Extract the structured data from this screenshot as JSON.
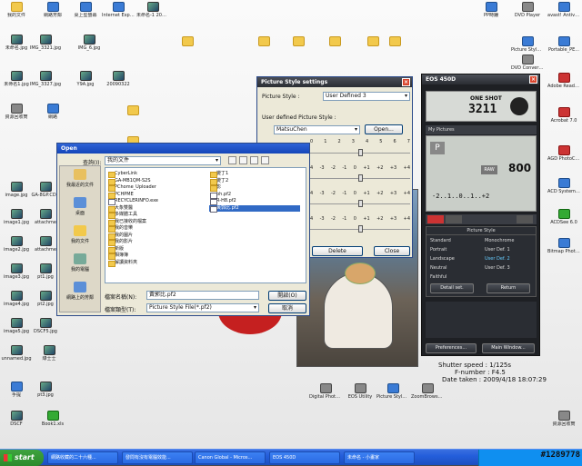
{
  "desktop": {
    "left_icons": [
      {
        "label": "我的文件",
        "icon": "folder"
      },
      {
        "label": "網路芳鄰",
        "icon": "app"
      },
      {
        "label": "桌上型螢幕",
        "icon": "app"
      },
      {
        "label": "Internet Explorer",
        "icon": "app"
      },
      {
        "label": "未命名-1 2009/2/27",
        "icon": "img"
      },
      {
        "label": "未命名.jpg",
        "icon": "img"
      },
      {
        "label": "IMG_3321.jpg",
        "icon": "img"
      },
      {
        "label": "IMG_6.jpg",
        "icon": "img"
      },
      {
        "label": "未命名1.jpg",
        "icon": "img"
      },
      {
        "label": "IMG_3327.jpg",
        "icon": "img"
      },
      {
        "label": "Y9A.jpg",
        "icon": "img"
      },
      {
        "label": "20090322",
        "icon": "img"
      },
      {
        "label": "資源回收筒",
        "icon": "gray"
      },
      {
        "label": "網路",
        "icon": "app"
      },
      {
        "label": "image.jpg",
        "icon": "img"
      },
      {
        "label": "GA-8GP.CDD",
        "icon": "img"
      },
      {
        "label": "image1.jpg",
        "icon": "img"
      },
      {
        "label": "attachme",
        "icon": "img"
      },
      {
        "label": "image2.jpg",
        "icon": "img"
      },
      {
        "label": "attachme",
        "icon": "img"
      },
      {
        "label": "image3.jpg",
        "icon": "img"
      },
      {
        "label": "pt1.jpg",
        "icon": "img"
      },
      {
        "label": "image4.jpg",
        "icon": "img"
      },
      {
        "label": "pt2.jpg",
        "icon": "img"
      },
      {
        "label": "image5.jpg",
        "icon": "img"
      },
      {
        "label": "DSCF5.jpg",
        "icon": "img"
      },
      {
        "label": "unnamed.jpg",
        "icon": "img"
      },
      {
        "label": "綠士士",
        "icon": "img"
      },
      {
        "label": "手提",
        "icon": "app"
      },
      {
        "label": "pt3.jpg",
        "icon": "img"
      },
      {
        "label": "DSCF",
        "icon": "img"
      },
      {
        "label": "Book1.xls",
        "icon": "green"
      }
    ],
    "top_icons": [
      {
        "label": "",
        "icon": "folder"
      },
      {
        "label": "",
        "icon": "folder"
      },
      {
        "label": "",
        "icon": "folder"
      },
      {
        "label": "",
        "icon": "folder"
      },
      {
        "label": "",
        "icon": "folder"
      },
      {
        "label": "",
        "icon": "folder"
      },
      {
        "label": "",
        "icon": "folder"
      },
      {
        "label": "",
        "icon": "folder"
      }
    ],
    "right_icons": [
      {
        "label": "PP時鐘",
        "icon": "app"
      },
      {
        "label": "DVD Player",
        "icon": "gray"
      },
      {
        "label": "avast! Antivirus",
        "icon": "app"
      },
      {
        "label": "Picture Style Editor",
        "icon": "app"
      },
      {
        "label": "DVD Converter",
        "icon": "gray"
      },
      {
        "label": "Portable_PE...",
        "icon": "app"
      },
      {
        "label": "Adobe Reader 7.0",
        "icon": "red"
      },
      {
        "label": "Acrobat 7.0",
        "icon": "red"
      },
      {
        "label": "AGD PhotoCa...",
        "icon": "red"
      },
      {
        "label": "ACD Systems Sv...",
        "icon": "app"
      },
      {
        "label": "ACDSee 6.0",
        "icon": "green"
      },
      {
        "label": "Bitmap PhotoCap.exe",
        "icon": "app"
      }
    ],
    "bottom_icons": [
      {
        "label": "Digital Photo Professional",
        "icon": "gray"
      },
      {
        "label": "EOS Utility",
        "icon": "gray"
      },
      {
        "label": "Picture Style Editor",
        "icon": "app"
      },
      {
        "label": "ZoomBrowser EX",
        "icon": "gray"
      }
    ],
    "recycle": {
      "label": "資源回收筒",
      "icon": "gray"
    }
  },
  "open_dialog": {
    "title": "Open",
    "lookin_label": "查詢(I):",
    "lookin_value": "我的文件",
    "places": [
      "我最近的文件",
      "桌面",
      "我的文件",
      "我的電腦",
      "網路上的芳鄰"
    ],
    "files_col1": [
      "CyberLink",
      "GA-MB1QM-S2S",
      "PChome_Uploader",
      "PCHPME",
      "RECYCLERINFO.exe",
      "大象雙醫",
      "多媒體工具",
      "我已接收的檔案",
      "我的音樂",
      "我的圖片",
      "我的影片",
      "新版",
      "相簿簿",
      "解讀資料夾"
    ],
    "files_col2": [
      "變丁1",
      "變丁2",
      "影",
      "bh.pf2",
      "R-H8.pf2",
      "黃郭比.pf2"
    ],
    "selected_file": "黃郭比.pf2",
    "filename_label": "檔案名稱(N):",
    "filename_value": "黃郭比.pf2",
    "filetype_label": "檔案類型(T):",
    "filetype_value": "Picture Style File(*.pf2)",
    "open_button": "開啟(O)",
    "cancel_button": "取消"
  },
  "picture_style_settings": {
    "title": "Picture Style settings",
    "style_label": "Picture Style :",
    "style_value": "User Defined 3",
    "udps_label": "User defined Picture Style :",
    "udps_value": "MatsuChen",
    "open_button": "Open...",
    "scale_top": [
      "0",
      "1",
      "2",
      "3",
      "4",
      "5",
      "6",
      "7"
    ],
    "scale_rows": [
      "4",
      "-3",
      "-2",
      "-1",
      "0",
      "+1",
      "+2",
      "+3",
      "+4"
    ],
    "delete_button": "Delete",
    "close_button": "Close"
  },
  "eos": {
    "title": "EOS 450D",
    "mode": "ONE SHOT",
    "shots": "3211",
    "folder": "My Pictures",
    "iso": "800",
    "raw": "RAW",
    "scale": "-2..1..0..1..+2",
    "ps_title": "Picture Style",
    "ps_items": [
      "Standard",
      "Monochrome",
      "Portrait",
      "User Def. 1",
      "Landscape",
      "User Def. 2",
      "Neutral",
      "User Def. 3",
      "Faithful",
      ""
    ],
    "detail_button": "Detail set.",
    "return_button": "Return",
    "prefs_button": "Preferences...",
    "main_button": "Main Window..."
  },
  "exif": [
    {
      "label": "Shutter speed :",
      "value": "1/125s"
    },
    {
      "label": "F-number :",
      "value": "F4.5"
    },
    {
      "label": "Date taken :",
      "value": "2009/4/18 18:07:29"
    }
  ],
  "taskbar": {
    "start": "start",
    "tasks": [
      "網路收藏的二十六種...",
      "發問有沒有電腦效能...",
      "Canon Global - Micros...",
      "EOS 450D",
      "未命名 - 小畫家"
    ],
    "watermark": "#1289778"
  }
}
